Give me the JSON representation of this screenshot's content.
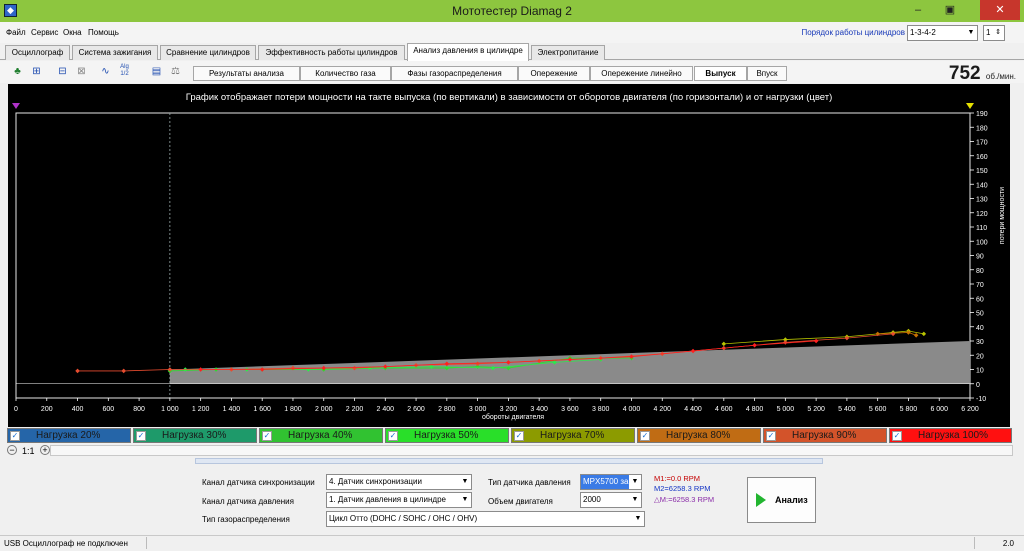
{
  "window": {
    "title": "Мототестер Diamag 2",
    "icon": "app-icon"
  },
  "menu": {
    "items": [
      "Файл",
      "Сервис",
      "Окна",
      "Помощь"
    ],
    "cylinder_order_label": "Порядок работы цилиндров",
    "cylinder_order_value": "1-3-4-2",
    "cylinder_number": "1"
  },
  "tabs": [
    {
      "label": "Осциллограф",
      "active": false
    },
    {
      "label": "Система зажигания",
      "active": false
    },
    {
      "label": "Сравнение цилиндров",
      "active": false
    },
    {
      "label": "Эффективность работы цилиндров",
      "active": false
    },
    {
      "label": "Анализ давления в цилиндре",
      "active": true
    },
    {
      "label": "Электропитание",
      "active": false
    }
  ],
  "toolbar": {
    "icons": [
      "tree-icon",
      "chart-icon",
      "chart-2-icon",
      "chart-3-icon",
      "line-icon",
      "algo-icon",
      "save-icon",
      "scale-icon"
    ],
    "algo_label": "Alg 1/2",
    "subtabs": [
      {
        "label": "Результаты анализа",
        "active": false
      },
      {
        "label": "Количество газа",
        "active": false
      },
      {
        "label": "Фазы газораспределения",
        "active": false
      },
      {
        "label": "Опережение",
        "active": false
      },
      {
        "label": "Опережение линейно",
        "active": false
      },
      {
        "label": "Выпуск",
        "active": true
      },
      {
        "label": "Впуск",
        "active": false
      }
    ],
    "rpm_value": "752",
    "rpm_unit": "об./мин."
  },
  "chart_title": "График отображает потери мощности на такте выпуска (по вертикали) в зависимости от оборотов двигателя (по горизонтали) и от нагрузки (цвет)",
  "chart_data": {
    "type": "scatter",
    "xlabel": "обороты двигателя",
    "ylabel": "потери мощности",
    "xlim": [
      0,
      6200
    ],
    "ylim": [
      -10,
      190
    ],
    "x_ticks": [
      "0",
      "200",
      "400",
      "600",
      "800",
      "1 000",
      "1 200",
      "1 400",
      "1 600",
      "1 800",
      "2 000",
      "2 200",
      "2 400",
      "2 600",
      "2 800",
      "3 000",
      "3 200",
      "3 400",
      "3 600",
      "3 800",
      "4 000",
      "4 200",
      "4 400",
      "4 600",
      "4 800",
      "5 000",
      "5 200",
      "5 400",
      "5 600",
      "5 800",
      "6 000",
      "6 200"
    ],
    "x_tick_values": [
      0,
      200,
      400,
      600,
      800,
      1000,
      1200,
      1400,
      1600,
      1800,
      2000,
      2200,
      2400,
      2600,
      2800,
      3000,
      3200,
      3400,
      3600,
      3800,
      4000,
      4200,
      4400,
      4600,
      4800,
      5000,
      5200,
      5400,
      5600,
      5800,
      6000,
      6200
    ],
    "y_ticks": [
      -10,
      0,
      10,
      20,
      30,
      40,
      50,
      60,
      70,
      80,
      90,
      100,
      110,
      120,
      130,
      140,
      150,
      160,
      170,
      180,
      190
    ],
    "gray_band": {
      "x": [
        1000,
        6200
      ],
      "y_start": 0,
      "y_end": 30
    },
    "series": [
      {
        "name": "Нагрузка 20%",
        "color": "#3a7fd0",
        "x": [],
        "y": []
      },
      {
        "name": "Нагрузка 30%",
        "color": "#26c481",
        "x": [],
        "y": []
      },
      {
        "name": "Нагрузка 40%",
        "color": "#2ddc2d",
        "x": [
          1000,
          1300,
          1600,
          2000,
          2400,
          2800,
          3000,
          3200,
          3600,
          4000
        ],
        "y": [
          9,
          10,
          10,
          10,
          11,
          11,
          12,
          11,
          18,
          18
        ]
      },
      {
        "name": "Нагрузка 50%",
        "color": "#2ee84a",
        "x": [
          1100,
          1500,
          1900,
          2300,
          2700,
          3100,
          3500,
          3800
        ],
        "y": [
          10,
          10,
          10,
          11,
          12,
          11,
          15,
          17
        ]
      },
      {
        "name": "Нагрузка 70%",
        "color": "#b8c400",
        "x": [
          4600,
          5000,
          5400,
          5700,
          5800,
          5900
        ],
        "y": [
          28,
          31,
          33,
          36,
          37,
          35
        ]
      },
      {
        "name": "Нагрузка 80%",
        "color": "#c57000",
        "x": [
          5600,
          5800,
          5850
        ],
        "y": [
          35,
          36,
          34
        ]
      },
      {
        "name": "Нагрузка 90%",
        "color": "#e74c2f",
        "x": [
          400,
          700,
          1000,
          1400,
          1800,
          2200,
          2600,
          3000,
          3400,
          3800,
          4200,
          4600,
          5000,
          5400,
          5700
        ],
        "y": [
          9,
          9,
          10,
          10,
          11,
          11,
          13,
          14,
          16,
          18,
          21,
          25,
          29,
          32,
          35
        ]
      },
      {
        "name": "Нагрузка 100%",
        "color": "#ff1f1f",
        "x": [
          1200,
          1600,
          2000,
          2400,
          2800,
          3200,
          3600,
          4000,
          4400,
          4800,
          5200
        ],
        "y": [
          10,
          10,
          11,
          12,
          14,
          15,
          17,
          19,
          23,
          27,
          30
        ]
      }
    ]
  },
  "legend": [
    {
      "label": "Нагрузка 20%",
      "color": "#2565a8"
    },
    {
      "label": "Нагрузка 30%",
      "color": "#1e9a6a"
    },
    {
      "label": "Нагрузка 40%",
      "color": "#31c231"
    },
    {
      "label": "Нагрузка 50%",
      "color": "#29df29"
    },
    {
      "label": "Нагрузка 70%",
      "color": "#8c9b00"
    },
    {
      "label": "Нагрузка 80%",
      "color": "#c06c14"
    },
    {
      "label": "Нагрузка 90%",
      "color": "#d3532a"
    },
    {
      "label": "Нагрузка 100%",
      "color": "#ff1010"
    }
  ],
  "zoom": {
    "value": "1:1"
  },
  "form": {
    "sync_label": "Канал датчика синхронизации",
    "sync_value": "4. Датчик синхронизации",
    "pressure_channel_label": "Канал датчика давления",
    "pressure_channel_value": "1. Датчик давления в цилиндре",
    "timing_label": "Тип газораспределения",
    "timing_value": "Цикл Отто (DOHC / SOHC / OHC / OHV)",
    "pressure_type_label": "Тип датчика давления",
    "pressure_type_value": "MPX5700 за",
    "engine_volume_label": "Объем двигателя",
    "engine_volume_value": "2000",
    "m1": "M1:=0.0 RPM",
    "m2": "M2=6258.3 RPM",
    "dm": "△M:=6258.3 RPM",
    "analyze_label": "Анализ"
  },
  "status": {
    "left": "USB Осциллограф не подключен",
    "right": "2.0"
  }
}
